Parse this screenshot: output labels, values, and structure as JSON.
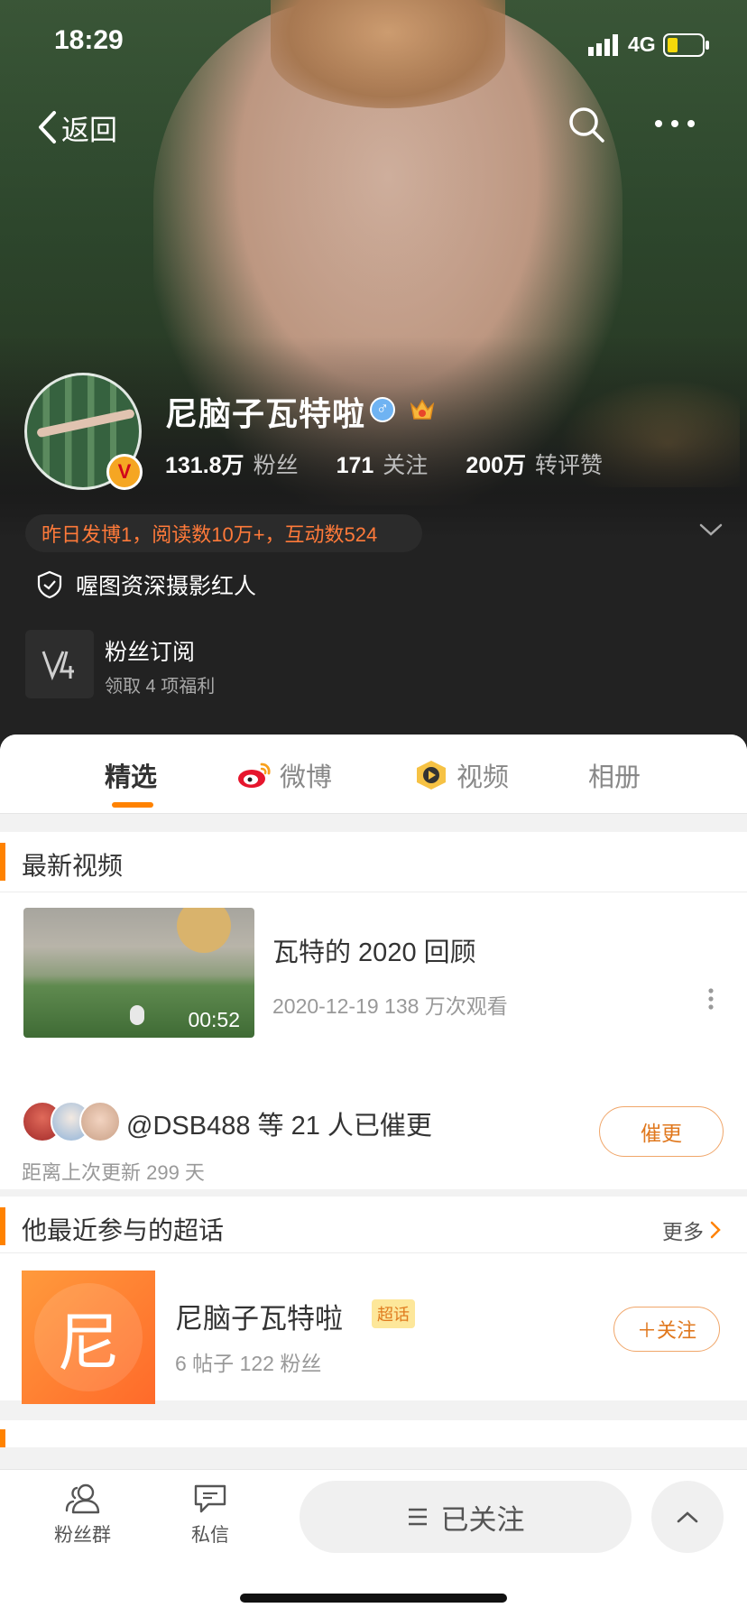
{
  "status_bar": {
    "time": "18:29",
    "network": "4G"
  },
  "nav": {
    "back_label": "返回"
  },
  "profile": {
    "name": "尼脑子瓦特啦",
    "gender_symbol": "♂",
    "followers_count": "131.8万",
    "followers_label": "粉丝",
    "following_count": "171",
    "following_label": "关注",
    "likes_count": "200万",
    "likes_label": "转评赞",
    "verified_badge": "V",
    "activity": "昨日发博1，阅读数10万+，互动数524",
    "certification": "喔图资深摄影红人",
    "subscription_title": "粉丝订阅",
    "subscription_subtitle": "领取 4 项福利"
  },
  "tabs": [
    {
      "label": "精选",
      "active": true
    },
    {
      "label": "微博",
      "active": false
    },
    {
      "label": "视频",
      "active": false
    },
    {
      "label": "相册",
      "active": false
    }
  ],
  "latest_video": {
    "section_title": "最新视频",
    "title": "瓦特的 2020 回顾",
    "meta": "2020-12-19 138 万次观看",
    "duration": "00:52",
    "urge_text": "@DSB488 等 21 人已催更",
    "last_update": "距离上次更新 299 天",
    "urge_button": "催更"
  },
  "super_topic": {
    "section_title": "他最近参与的超话",
    "more_label": "更多",
    "icon_char": "尼",
    "name": "尼脑子瓦特啦",
    "tag": "超话",
    "stats": "6 帖子 122 粉丝",
    "follow_button": "＋关注"
  },
  "bottom_bar": {
    "fans_group": "粉丝群",
    "messages": "私信",
    "followed": "已关注"
  },
  "colors": {
    "accent": "#ff8200",
    "activity": "#ff7a3a",
    "verified": "#f5a623"
  }
}
